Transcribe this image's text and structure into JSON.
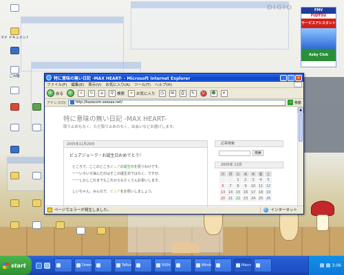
{
  "desktop": {
    "icons": [
      {
        "label": "",
        "kind": "doc"
      },
      {
        "label": "マイ ドキュメント",
        "kind": "folder"
      },
      {
        "label": "",
        "kind": "blue"
      },
      {
        "label": "ごみ箱",
        "kind": "doc"
      },
      {
        "label": "",
        "kind": "doc"
      },
      {
        "label": "",
        "kind": "red"
      },
      {
        "label": "",
        "kind": "green"
      },
      {
        "label": "",
        "kind": "doc"
      },
      {
        "label": "",
        "kind": "doc"
      },
      {
        "label": "",
        "kind": "blue"
      },
      {
        "label": "",
        "kind": "folder"
      },
      {
        "label": "",
        "kind": "doc"
      },
      {
        "label": "",
        "kind": "folder"
      },
      {
        "label": "",
        "kind": "folder"
      },
      {
        "label": "",
        "kind": "doc"
      },
      {
        "label": "",
        "kind": "folder"
      },
      {
        "label": "",
        "kind": "folder"
      },
      {
        "label": "",
        "kind": "folder"
      },
      {
        "label": "",
        "kind": "doc"
      },
      {
        "label": "",
        "kind": "folder"
      },
      {
        "label": "",
        "kind": "doc"
      },
      {
        "label": "",
        "kind": "folder"
      }
    ],
    "ad": {
      "line1": "FMV",
      "line2": "FUJITSU",
      "line3": "サービスアシスタント",
      "line4": "",
      "line5": "Azby Club"
    },
    "watermark": "DIGIO"
  },
  "ie_window": {
    "title": "特に意味の無い日記 -MAX HEART- - Microsoft Internet Explorer",
    "menu": [
      "ファイル(F)",
      "編集(E)",
      "表示(V)",
      "お気に入り(A)",
      "ツール(T)",
      "ヘルプ(H)"
    ],
    "toolbar": {
      "back": "戻る",
      "search": "検索",
      "favorites": "お気に入り"
    },
    "address_label": "アドレス(D)",
    "address": "http://kazacom.seesaa.net/",
    "go_label": "移動",
    "status_text": "ページでエラーが発生しました。",
    "status_zone": "インターネット"
  },
  "page": {
    "blog_title": "特に意味の無い日記 -MAX HEART-",
    "blog_subtitle": "取り止めもなく、ただ取り止めのなく、出会いなどお届けします。",
    "post": {
      "date": "2005年11月29日",
      "title": "ピュアジョーク・お誕生日おめでとう！",
      "line1_pre": "ところで、ここのところ",
      "line1_hl1": "ピュア",
      "line1_mid": "の",
      "line1_hl2": "誕生日",
      "line1_post": "を祝うわけです。",
      "line2": "ーーいろいろ悩んだのはそこの誕生日ではなく、ですが、",
      "line3": "ーーしかしこれまでもこれからもたくさんお祝いします。",
      "line4_pre": "しいちゃん、みんなで、",
      "line4_hl": "ピュア",
      "line4_post": "をお祝いしましょう。"
    },
    "sidebar": {
      "search_head": "記事検索",
      "search_placeholder": "",
      "search_button": "検索",
      "calendar_head": "2005年 11月",
      "calendar": {
        "headers": [
          "日",
          "月",
          "火",
          "水",
          "木",
          "金",
          "土"
        ],
        "rows": [
          [
            "",
            "",
            "1",
            "2",
            "3",
            "4",
            "5"
          ],
          [
            "6",
            "7",
            "8",
            "9",
            "10",
            "11",
            "12"
          ],
          [
            "13",
            "14",
            "15",
            "16",
            "17",
            "18",
            "19"
          ],
          [
            "20",
            "21",
            "22",
            "23",
            "24",
            "25",
            "26"
          ]
        ]
      }
    }
  },
  "taskbar": {
    "start_label": "start",
    "tasks": [
      "",
      "DownE",
      "",
      "ToRun",
      "",
      "500h",
      "",
      "Windo",
      "",
      "Macro",
      ""
    ],
    "active_task": 9,
    "time": "3:06"
  },
  "colors": {
    "titlebar": "#0c45c9",
    "taskbar": "#245ad0",
    "start": "#2f8f2f",
    "link_highlight": "#2a9a2a"
  }
}
